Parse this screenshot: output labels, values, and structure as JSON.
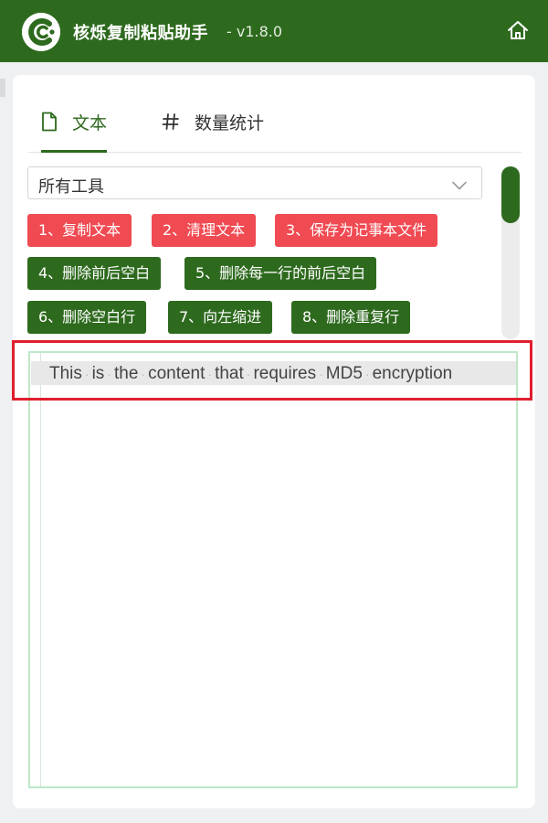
{
  "app": {
    "title": "核烁复制粘贴助手",
    "version": "- v1.8.0",
    "logo_icon": "cc-logo-icon",
    "home_icon": "home-icon"
  },
  "colors": {
    "brand_green": "#2e6a1e",
    "button_red": "#f04a52",
    "highlight_red": "#e01f2e",
    "editor_border": "#bfe8c9"
  },
  "tabs": [
    {
      "label": "文本",
      "icon": "document-icon",
      "active": true
    },
    {
      "label": "数量统计",
      "icon": "hash-icon",
      "active": false
    }
  ],
  "tool_filter": {
    "selected": "所有工具",
    "icon": "chevron-down-icon"
  },
  "tools": [
    {
      "label": "1、复制文本",
      "color": "red"
    },
    {
      "label": "2、清理文本",
      "color": "red"
    },
    {
      "label": "3、保存为记事本文件",
      "color": "red"
    },
    {
      "label": "4、删除前后空白",
      "color": "green"
    },
    {
      "label": "5、删除每一行的前后空白",
      "color": "green"
    },
    {
      "label": "6、删除空白行",
      "color": "green"
    },
    {
      "label": "7、向左缩进",
      "color": "green"
    },
    {
      "label": "8、删除重复行",
      "color": "green"
    }
  ],
  "editor": {
    "words": [
      "This",
      "is",
      "the",
      "content",
      "that",
      "requires",
      "MD5",
      "encryption"
    ]
  }
}
